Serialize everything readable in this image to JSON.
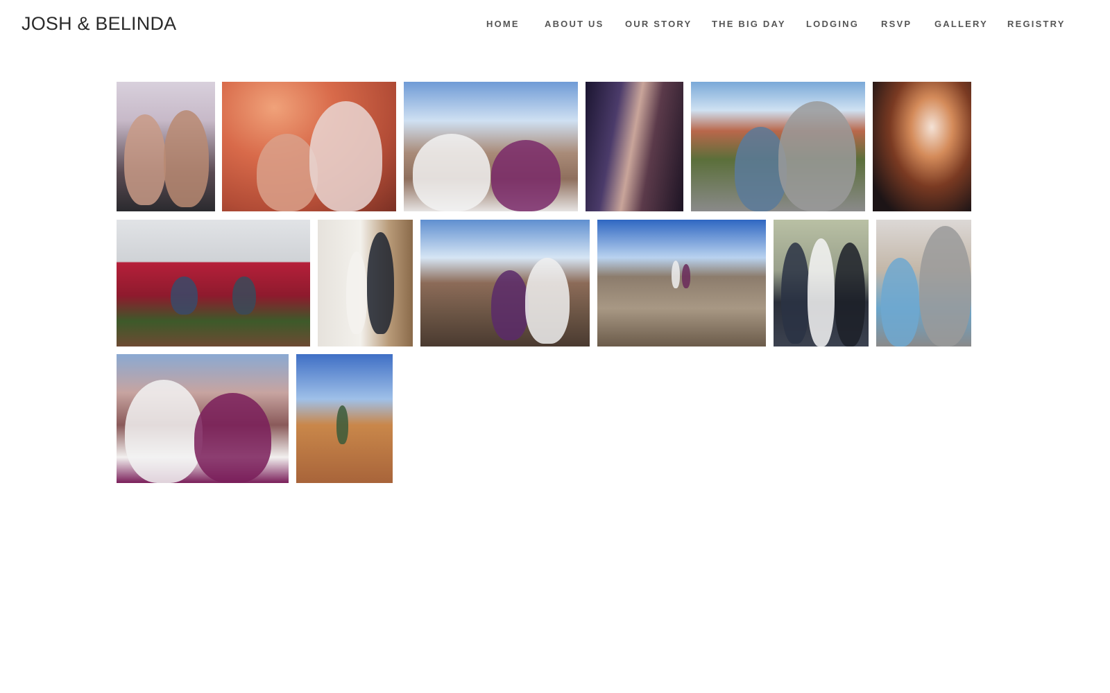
{
  "site": {
    "title": "JOSH & BELINDA"
  },
  "nav": {
    "items": [
      {
        "label": "HOME",
        "id": "home"
      },
      {
        "label": "ABOUT US",
        "id": "about-us"
      },
      {
        "label": "OUR STORY",
        "id": "our-story"
      },
      {
        "label": "THE BIG DAY",
        "id": "the-big-day"
      },
      {
        "label": "LODGING",
        "id": "lodging"
      },
      {
        "label": "RSVP",
        "id": "rsvp"
      },
      {
        "label": "GALLERY",
        "id": "gallery"
      },
      {
        "label": "REGISTRY",
        "id": "registry"
      }
    ]
  },
  "colors": {
    "title_text": "#2b2b2b",
    "nav_text": "#555555",
    "background": "#ffffff"
  },
  "gallery": {
    "photos": [
      {
        "id": "selfie-sports-fans"
      },
      {
        "id": "antelope-canyon-selfie"
      },
      {
        "id": "canyon-overlook-couple"
      },
      {
        "id": "slot-canyon-dark"
      },
      {
        "id": "red-rock-hike-selfie"
      },
      {
        "id": "slot-canyon-heart"
      },
      {
        "id": "tulip-field"
      },
      {
        "id": "formal-couple-indoor"
      },
      {
        "id": "canyon-rim-couple"
      },
      {
        "id": "canyon-cliff-edge"
      },
      {
        "id": "three-men-formal"
      },
      {
        "id": "man-with-toddler"
      },
      {
        "id": "silly-faces-selfie"
      },
      {
        "id": "red-dirt-climb"
      }
    ]
  }
}
